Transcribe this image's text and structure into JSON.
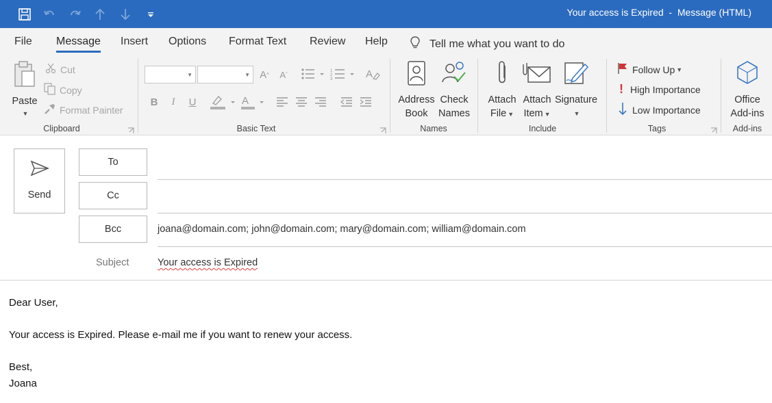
{
  "window": {
    "title": "Your access is Expired  -  Message (HTML)"
  },
  "tabs": [
    {
      "label": "File"
    },
    {
      "label": "Message",
      "active": true
    },
    {
      "label": "Insert"
    },
    {
      "label": "Options"
    },
    {
      "label": "Format Text"
    },
    {
      "label": "Review"
    },
    {
      "label": "Help"
    }
  ],
  "tell_me": {
    "label": "Tell me what you want to do",
    "icon": "lightbulb-icon"
  },
  "ribbon": {
    "clipboard": {
      "label": "Clipboard",
      "paste": "Paste",
      "cut": "Cut",
      "copy": "Copy",
      "format_painter": "Format Painter"
    },
    "basic_text": {
      "label": "Basic Text"
    },
    "names": {
      "label": "Names",
      "address_book": [
        "Address",
        "Book"
      ],
      "check_names": [
        "Check",
        "Names"
      ]
    },
    "include": {
      "label": "Include",
      "attach_file": [
        "Attach",
        "File"
      ],
      "attach_item": [
        "Attach",
        "Item"
      ],
      "signature": "Signature"
    },
    "tags": {
      "label": "Tags",
      "follow_up": "Follow Up",
      "high_importance": "High Importance",
      "low_importance": "Low Importance"
    },
    "addins": {
      "label": "Add-ins",
      "office_addins": [
        "Office",
        "Add-ins"
      ]
    }
  },
  "compose": {
    "send_label": "Send",
    "to_label": "To",
    "cc_label": "Cc",
    "bcc_label": "Bcc",
    "to_value": "",
    "cc_value": "",
    "bcc_value": "joana@domain.com; john@domain.com; mary@domain.com; william@domain.com",
    "subject_label": "Subject",
    "subject_value": "Your access is Expired"
  },
  "body": {
    "lines": [
      "Dear User,",
      "Your access is Expired. Please e-mail me if you want to renew your access.",
      "Best,",
      "Joana"
    ]
  },
  "colors": {
    "accent": "#2b6bbf",
    "ribbon_bg": "#f3f3f3",
    "flag": "#d13438"
  }
}
